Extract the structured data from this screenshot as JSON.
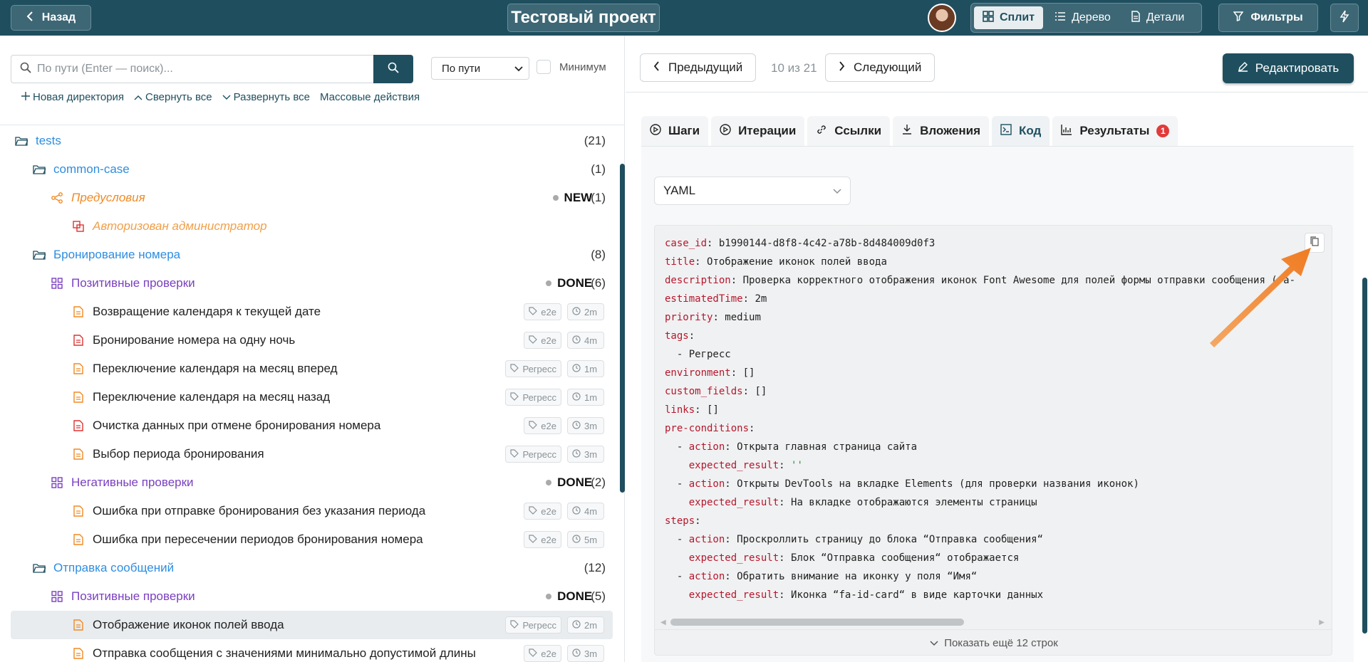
{
  "header": {
    "back_label": "Назад",
    "project_title": "Тестовый проект",
    "views": [
      {
        "label": "Сплит",
        "icon": "split-view-icon",
        "active": true
      },
      {
        "label": "Дерево",
        "icon": "list-icon",
        "active": false
      },
      {
        "label": "Детали",
        "icon": "document-icon",
        "active": false
      }
    ],
    "filters_label": "Фильтры"
  },
  "left": {
    "search_placeholder": "По пути (Enter — поиск)...",
    "sort_value": "По пути",
    "minimum_label": "Минимум",
    "actions": [
      {
        "icon": "plus-icon",
        "label": "Новая директория"
      },
      {
        "icon": "chevron-up-icon",
        "label": "Свернуть все"
      },
      {
        "icon": "chevron-down-icon",
        "label": "Развернуть все"
      },
      {
        "icon": "",
        "label": "Массовые действия"
      }
    ],
    "tree": [
      {
        "label": "tests",
        "count": "(21)"
      },
      {
        "label": "common-case",
        "count": "(1)"
      },
      {
        "label": "Предусловия",
        "status": "NEW",
        "status_count": "(1)"
      },
      {
        "label": "Авторизован администратор"
      },
      {
        "label": "Бронирование номера",
        "count": "(8)"
      },
      {
        "label": "Позитивные проверки",
        "status": "DONE",
        "status_count": "(6)"
      },
      {
        "label": "Возвращение календаря к текущей дате",
        "tag": "e2e",
        "time": "2m"
      },
      {
        "label": "Бронирование номера на одну ночь",
        "tag": "e2e",
        "time": "4m"
      },
      {
        "label": "Переключение календаря на месяц вперед",
        "tag": "Регресс",
        "time": "1m"
      },
      {
        "label": "Переключение календаря на месяц назад",
        "tag": "Регресс",
        "time": "1m"
      },
      {
        "label": "Очистка данных при отмене бронирования номера",
        "tag": "e2e",
        "time": "3m"
      },
      {
        "label": "Выбор периода бронирования",
        "tag": "Регресс",
        "time": "3m"
      },
      {
        "label": "Негативные проверки",
        "status": "DONE",
        "status_count": "(2)"
      },
      {
        "label": "Ошибка при отправке бронирования без указания периода",
        "tag": "e2e",
        "time": "4m"
      },
      {
        "label": "Ошибка при пересечении периодов бронирования номера",
        "tag": "e2e",
        "time": "5m"
      },
      {
        "label": "Отправка сообщений",
        "count": "(12)"
      },
      {
        "label": "Позитивные проверки",
        "status": "DONE",
        "status_count": "(5)"
      },
      {
        "label": "Отображение иконок полей ввода",
        "tag": "Регресс",
        "time": "2m"
      },
      {
        "label": "Отправка сообщения с значениями минимально допустимой длины",
        "tag": "e2e",
        "time": "3m"
      }
    ]
  },
  "right": {
    "prev_label": "Предыдущий",
    "pager": "10 из 21",
    "next_label": "Следующий",
    "edit_label": "Редактировать",
    "tabs": [
      {
        "label": "Шаги",
        "icon": "play-circle-icon"
      },
      {
        "label": "Итерации",
        "icon": "play-circle-icon"
      },
      {
        "label": "Ссылки",
        "icon": "link-icon"
      },
      {
        "label": "Вложения",
        "icon": "download-icon"
      },
      {
        "label": "Код",
        "icon": "terminal-icon",
        "active": true
      },
      {
        "label": "Результаты",
        "icon": "bar-chart-icon",
        "badge": "1"
      }
    ],
    "format": "YAML",
    "code": {
      "case_id": "b1990144-d8f8-4c42-a78b-8d484009d0f3",
      "title": "Отображение иконок полей ввода",
      "description": "Проверка корректного отображения иконок Font Awesome для полей формы отправки сообщения (fa-",
      "estimatedTime": "2m",
      "priority": "medium",
      "tag_item": "- Регресс",
      "environment": "[]",
      "custom_fields": "[]",
      "links": "[]",
      "pre1_action": "Открыта главная страница сайта",
      "pre1_expected": "''",
      "pre2_action": "Открыты DevTools на вкладке Elements (для проверки названия иконок)",
      "pre2_expected": "На вкладке отображаются элементы страницы",
      "step1_action": "Проскроллить страницу до блока “Отправка сообщения“",
      "step1_expected": "Блок “Отправка сообщения“ отображается",
      "step2_action": "Обратить внимание на иконку у поля “Имя“",
      "step2_expected": "Иконка “fa-id-card“ в виде карточки данных"
    },
    "more_lines": "Показать ещё 12 строк"
  },
  "colors": {
    "brand": "#1f4f5f",
    "folder_blue": "#2e8de0",
    "precondition_orange": "#f08a24",
    "suite_purple": "#7a3fc0",
    "badge_red": "#e23a3a"
  }
}
